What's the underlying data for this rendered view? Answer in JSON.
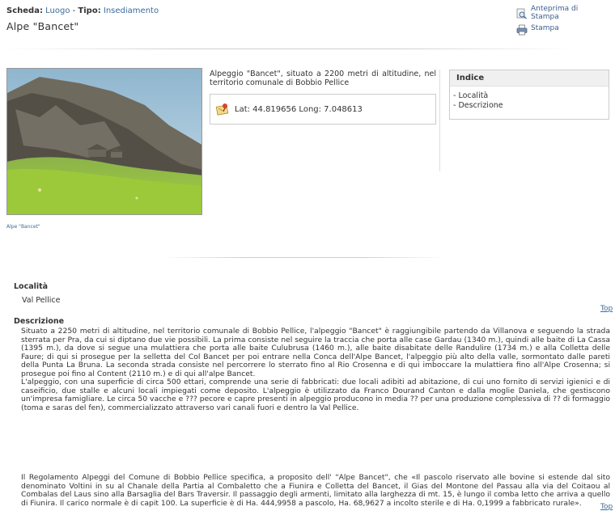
{
  "header": {
    "scheda_label": "Scheda:",
    "scheda_value": "Luogo",
    "separator": " - ",
    "tipo_label": "Tipo:",
    "tipo_value": "Insediamento",
    "title": "Alpe \"Bancet\""
  },
  "tools": {
    "preview_label": "Anteprima di Stampa",
    "print_label": "Stampa"
  },
  "photo": {
    "caption": "Alpe \"Bancet\""
  },
  "summary": "Alpeggio \"Bancet\", situato a 2200 metri di altitudine, nel territorio comunale di Bobbio Pellice",
  "geo": {
    "text": "Lat: 44.819656 Long: 7.048613"
  },
  "index": {
    "title": "Indice",
    "items": [
      "- Località",
      "- Descrizione"
    ]
  },
  "sections": {
    "locality_title": "Località",
    "locality_value": "Val Pellice",
    "top_label": "Top",
    "description_title": "Descrizione",
    "description_p1": "Situato a 2250 metri di altitudine, nel territorio comunale di Bobbio Pellice, l'alpeggio \"Bancet\" è raggiungibile partendo da Villanova e seguendo la strada sterrata per Pra, da cui si diptano due vie possibili. La prima consiste nel seguire la traccia che porta alle case Gardau (1340 m.), quindi alle baite di La Cassa (1395 m.), da dove si segue una mulattiera che porta alle baite Culubrusa (1460 m.), alle baite disabitate delle Randulire (1734 m.) e alla Colletta delle Faure; di qui si prosegue  per la selletta del Col Bancet per poi entrare nella Conca dell'Alpe Bancet, l'alpeggio più alto della valle, sormontato dalle pareti della Punta La Bruna. La seconda strada consiste nel percorrere lo sterrato fino al Rio Crosenna e di qui imboccare la mulattiera fino all'Alpe Crosenna; si prosegue poi fino al Content (2110 m.) e di qui all'alpe Bancet.",
    "description_p2": "L'alpeggio, con una superficie di circa 500 ettari, comprende una serie di fabbricati: due locali adibiti ad abitazione, di cui uno fornito di servizi igienici e di caseificio, due stalle e alcuni locali impiegati come deposito. L'alpeggio è utilizzato da Franco Dourand Canton e dalla moglie Daniela, che gestiscono un'impresa famigliare. Le circa 50 vacche e ??? pecore e capre presenti in alpeggio producono in media ?? per una produzione complessiva di ?? di formaggio (toma e saras del fen), commercializzato attraverso vari canali fuori e dentro la Val Pellice.",
    "description_p3": "Il Regolamento Alpeggi del Comune di Bobbio Pellice specifica, a proposito dell' \"Alpe Bancet\", che «Il pascolo riservato alle bovine si estende dal sito denominato Voltini in su al Chanale della Partia al Combaletto che a Fiunira e Colletta del Bancet, il Gias del Montone del Passau alla via del Coitaou al Combalas del Laus sino alla Barsaglia del Bars Traversir. Il passaggio degli armenti, limitato alla larghezza di mt. 15, è lungo il comba letto che arriva a quello di Fiunira. Il carico normale è di capit 100. La superficie è di Ha. 444,9958 a pascolo, Ha. 68,9627 a incolto sterile e di Ha. 0,1999 a fabbricato rurale»."
  }
}
